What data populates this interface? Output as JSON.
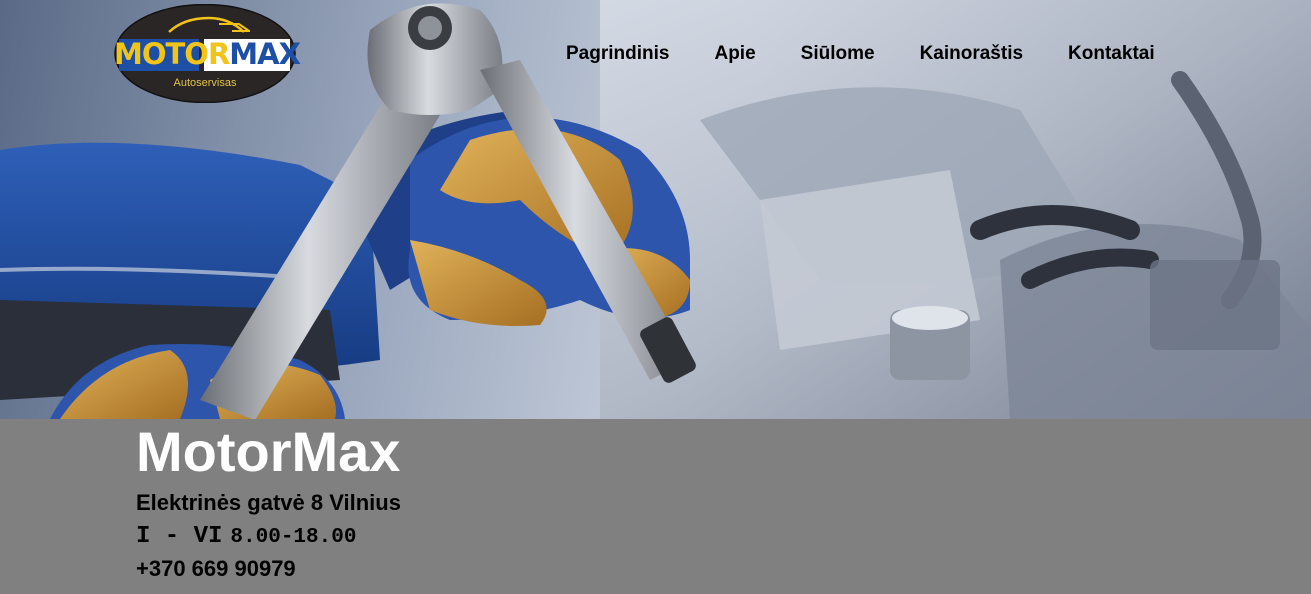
{
  "colors": {
    "logo_yellow": "#f2c318",
    "logo_blue": "#1d4fa6",
    "info_band": "#808080",
    "brand_text": "#ffffff",
    "nav_text": "#000000"
  },
  "logo": {
    "part1": "MOTOR",
    "part2": "MAX",
    "subtitle": "Autoservisas",
    "icon": "car-silhouette-icon"
  },
  "nav": {
    "items": [
      {
        "label": "Pagrindinis"
      },
      {
        "label": "Apie"
      },
      {
        "label": "Siūlome"
      },
      {
        "label": "Kainoraštis"
      },
      {
        "label": "Kontaktai"
      }
    ]
  },
  "hero": {
    "image": "mechanic-gloved-hands-ratchet-wrench-engine"
  },
  "info": {
    "brand": "MotorMax",
    "address": "Elektrinės gatvė 8 Vilnius",
    "hours_days": "I - VI",
    "hours_time": "8.00-18.00",
    "phone": "+370 669 90979"
  }
}
